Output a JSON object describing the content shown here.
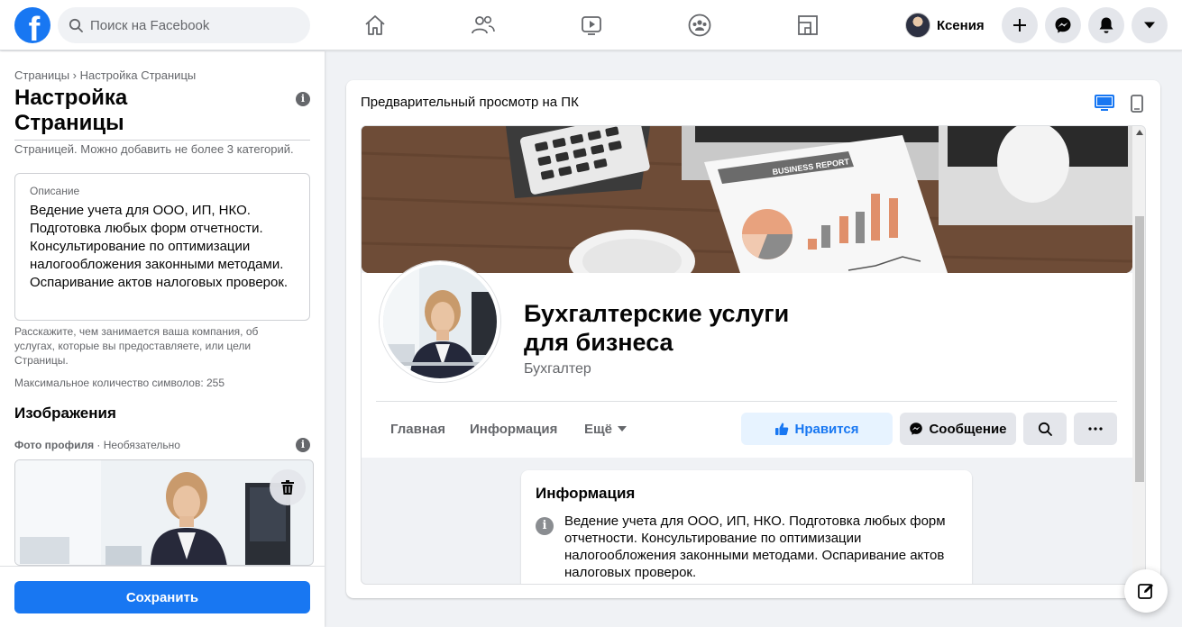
{
  "topbar": {
    "logo_letter": "f",
    "search_placeholder": "Поиск на Facebook",
    "nav_icons": [
      "home-icon",
      "friends-icon",
      "watch-icon",
      "groups-icon",
      "gaming-icon"
    ],
    "profile_name": "Ксения",
    "action_icons": [
      "plus-icon",
      "messenger-icon",
      "bell-icon",
      "caret-down-icon"
    ]
  },
  "left": {
    "breadcrumb": "Страницы › Настройка Страницы",
    "title": "Настройка Страницы",
    "category_note": "Страницей. Можно добавить не более 3 категорий.",
    "description_label": "Описание",
    "description_value": "Ведение учета для ООО, ИП, НКО. Подготовка любых форм отчетности. Консультирование по оптимизации налогообложения законными методами. Оспаривание актов налоговых проверок.",
    "help_text": "Расскажите, чем занимается ваша компания, об услугах, которые вы предоставляете, или цели Страницы.",
    "max_chars": "Максимальное количество символов: 255",
    "images_heading": "Изображения",
    "profile_photo_label": "Фото профиля",
    "profile_photo_optional": " · Необязательно",
    "save_label": "Сохранить"
  },
  "preview": {
    "title": "Предварительный просмотр на ПК",
    "cover_report_title": "BUSINESS REPORT",
    "page_name": "Бухгалтерские услуги для бизнеса",
    "page_category": "Бухгалтер",
    "tabs": [
      "Главная",
      "Информация",
      "Ещё"
    ],
    "like_label": "Нравится",
    "message_label": "Сообщение",
    "info_title": "Информация",
    "info_text": "Ведение учета для ООО, ИП, НКО. Подготовка любых форм отчетности. Консультирование по оптимизации налогообложения законными методами. Оспаривание актов налоговых проверок."
  },
  "colors": {
    "accent": "#1877f2",
    "like_bg": "#e7f3ff",
    "secondary_btn": "#e4e6eb",
    "muted_text": "#65676b"
  }
}
